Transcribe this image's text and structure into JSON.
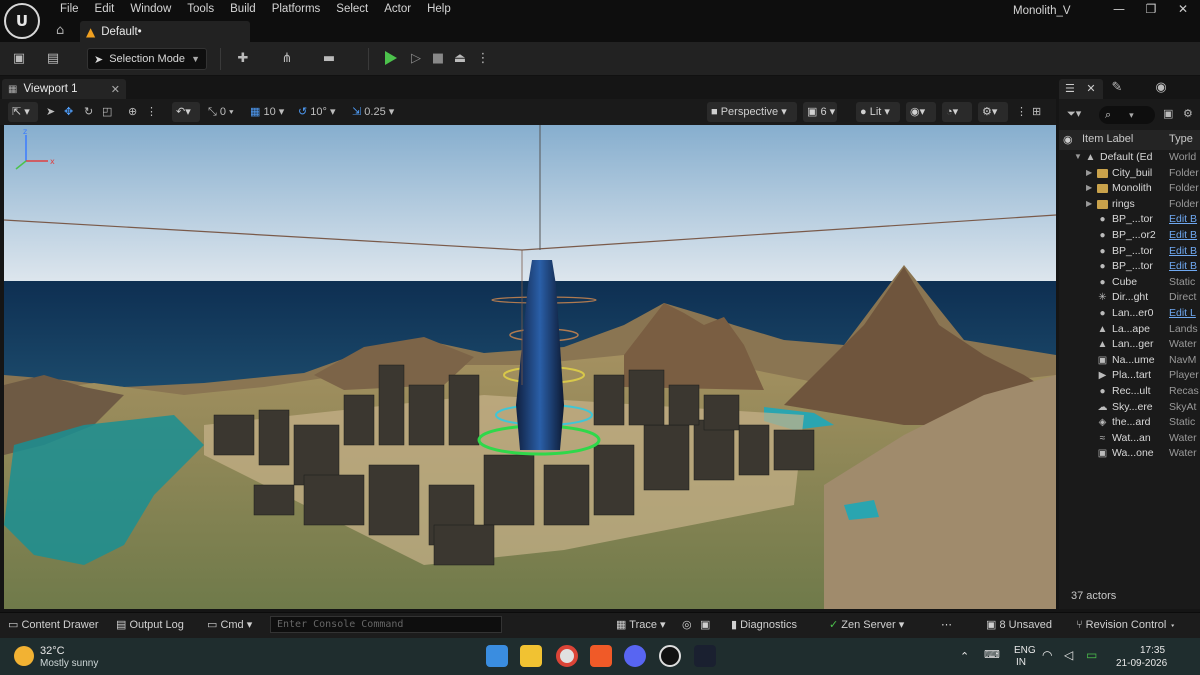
{
  "menubar": {
    "items": [
      "File",
      "Edit",
      "Window",
      "Tools",
      "Build",
      "Platforms",
      "Select",
      "Actor",
      "Help"
    ],
    "project_name": "Monolith_V",
    "document_tab": "Default•"
  },
  "toolbar": {
    "selection_mode": "Selection Mode"
  },
  "viewport_tab": {
    "label": "Viewport 1"
  },
  "viewport_toolbar": {
    "rotation_snap_count": "0",
    "grid_snap": "10",
    "rotate_snap": "10°",
    "scale_snap": "0.25",
    "view_mode": "Perspective",
    "camera_speed": "6",
    "lighting": "Lit"
  },
  "outliner": {
    "col_label": "Item Label",
    "col_type": "Type",
    "rows": [
      {
        "label": "Default (Ed",
        "type": "World",
        "indent": 0,
        "icon": "level-icon",
        "expanded": true
      },
      {
        "label": "City_buil",
        "type": "Folder",
        "indent": 1,
        "icon": "folder-icon"
      },
      {
        "label": "Monolith",
        "type": "Folder",
        "indent": 1,
        "icon": "folder-icon"
      },
      {
        "label": "rings",
        "type": "Folder",
        "indent": 1,
        "icon": "folder-icon"
      },
      {
        "label": "BP_...tor",
        "type": "Edit B",
        "indent": 1,
        "icon": "sphere-icon",
        "link": true
      },
      {
        "label": "BP_...or2",
        "type": "Edit B",
        "indent": 1,
        "icon": "sphere-icon",
        "link": true
      },
      {
        "label": "BP_...tor",
        "type": "Edit B",
        "indent": 1,
        "icon": "sphere-icon",
        "link": true
      },
      {
        "label": "BP_...tor",
        "type": "Edit B",
        "indent": 1,
        "icon": "sphere-icon",
        "link": true
      },
      {
        "label": "Cube",
        "type": "Static",
        "indent": 1,
        "icon": "sphere-icon"
      },
      {
        "label": "Dir...ght",
        "type": "Direct",
        "indent": 1,
        "icon": "sun-icon"
      },
      {
        "label": "Lan...er0",
        "type": "Edit L",
        "indent": 1,
        "icon": "sphere-icon",
        "link": true
      },
      {
        "label": "La...ape",
        "type": "Lands",
        "indent": 1,
        "icon": "landscape-icon"
      },
      {
        "label": "Lan...ger",
        "type": "Water",
        "indent": 1,
        "icon": "landscape-icon"
      },
      {
        "label": "Na...ume",
        "type": "NavM",
        "indent": 1,
        "icon": "navmesh-icon"
      },
      {
        "label": "Pla...tart",
        "type": "Player",
        "indent": 1,
        "icon": "player-start-icon"
      },
      {
        "label": "Rec...ult",
        "type": "Recas",
        "indent": 1,
        "icon": "sphere-icon"
      },
      {
        "label": "Sky...ere",
        "type": "SkyAt",
        "indent": 1,
        "icon": "sky-icon"
      },
      {
        "label": "the...ard",
        "type": "Static",
        "indent": 1,
        "icon": "cube-icon"
      },
      {
        "label": "Wat...an",
        "type": "Water",
        "indent": 1,
        "icon": "water-icon"
      },
      {
        "label": "Wa...one",
        "type": "Water",
        "indent": 1,
        "icon": "water-zone-icon"
      }
    ],
    "actor_count": "37 actors"
  },
  "statusbar": {
    "content_drawer": "Content Drawer",
    "output_log": "Output Log",
    "cmd": "Cmd",
    "console_placeholder": "Enter Console Command",
    "trace": "Trace",
    "diagnostics": "Diagnostics",
    "zen_server": "Zen Server",
    "unsaved": "8 Unsaved",
    "revision_control": "Revision Control"
  },
  "taskbar": {
    "temperature": "32°C",
    "weather": "Mostly sunny",
    "lang_top": "ENG",
    "lang_bottom": "IN",
    "time": "17:35",
    "date": "21-09-2026"
  },
  "colors": {
    "accent_play": "#4cc24c",
    "link": "#6fa8f0",
    "folder": "#c9a24b",
    "warning": "#f0a020"
  }
}
